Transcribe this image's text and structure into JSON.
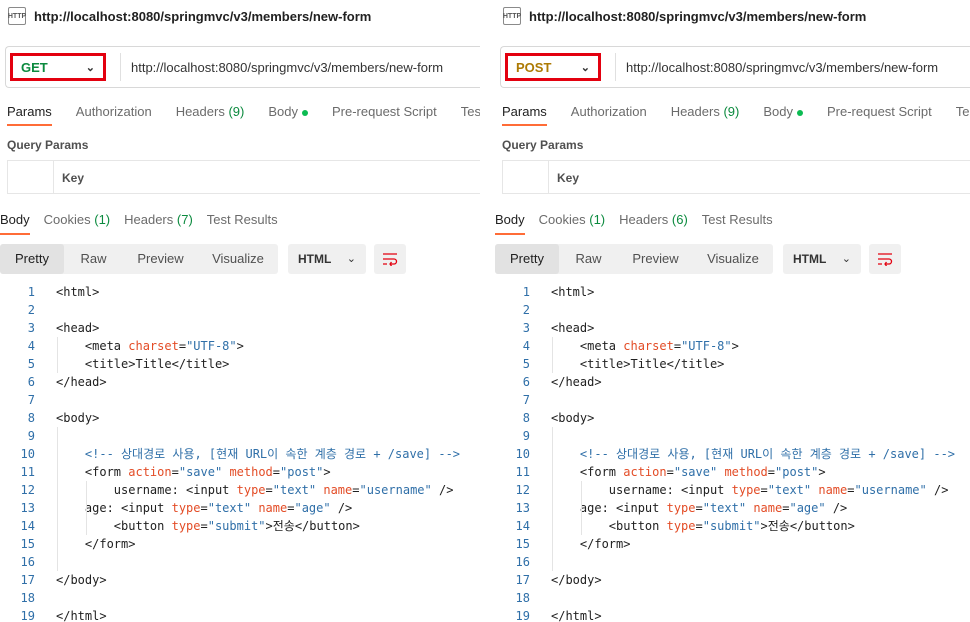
{
  "panels": [
    {
      "id": "left",
      "title_url": "http://localhost:8080/springmvc/v3/members/new-form",
      "method": "GET",
      "url": "http://localhost:8080/springmvc/v3/members/new-form",
      "request_tabs": [
        {
          "label": "Params",
          "active": true
        },
        {
          "label": "Authorization"
        },
        {
          "label": "Headers",
          "count": "(9)"
        },
        {
          "label": "Body",
          "dot": true
        },
        {
          "label": "Pre-request Script"
        },
        {
          "label": "Tes"
        }
      ],
      "query_params_title": "Query Params",
      "kv_key_header": "Key",
      "response_tabs": [
        {
          "label": "Body",
          "active": true
        },
        {
          "label": "Cookies",
          "count": "(1)"
        },
        {
          "label": "Headers",
          "count": "(7)"
        },
        {
          "label": "Test Results"
        }
      ],
      "format_tabs": [
        "Pretty",
        "Raw",
        "Preview",
        "Visualize"
      ],
      "format_active": "Pretty",
      "language": "HTML"
    },
    {
      "id": "right",
      "title_url": "http://localhost:8080/springmvc/v3/members/new-form",
      "method": "POST",
      "url": "http://localhost:8080/springmvc/v3/members/new-form",
      "request_tabs": [
        {
          "label": "Params",
          "active": true
        },
        {
          "label": "Authorization"
        },
        {
          "label": "Headers",
          "count": "(9)"
        },
        {
          "label": "Body",
          "dot": true
        },
        {
          "label": "Pre-request Script"
        },
        {
          "label": "Te"
        }
      ],
      "query_params_title": "Query Params",
      "kv_key_header": "Key",
      "response_tabs": [
        {
          "label": "Body",
          "active": true
        },
        {
          "label": "Cookies",
          "count": "(1)"
        },
        {
          "label": "Headers",
          "count": "(6)"
        },
        {
          "label": "Test Results"
        }
      ],
      "format_tabs": [
        "Pretty",
        "Raw",
        "Preview",
        "Visualize"
      ],
      "format_active": "Pretty",
      "language": "HTML"
    }
  ],
  "code_lines": [
    [
      {
        "t": "<html>",
        "c": "tag"
      }
    ],
    [],
    [
      {
        "t": "<head>",
        "c": "tag"
      }
    ],
    [
      {
        "t": "    <meta ",
        "c": "tag"
      },
      {
        "t": "charset",
        "c": "attr"
      },
      {
        "t": "=",
        "c": "tag"
      },
      {
        "t": "\"UTF-8\"",
        "c": "val"
      },
      {
        "t": ">",
        "c": "tag"
      }
    ],
    [
      {
        "t": "    <title>",
        "c": "tag"
      },
      {
        "t": "Title",
        "c": "tag"
      },
      {
        "t": "</title>",
        "c": "tag"
      }
    ],
    [
      {
        "t": "</head>",
        "c": "tag"
      }
    ],
    [],
    [
      {
        "t": "<body>",
        "c": "tag"
      }
    ],
    [],
    [
      {
        "t": "    <!-- 상대경로 사용, [현재 URL이 속한 계층 경로 + /save] -->",
        "c": "com"
      }
    ],
    [
      {
        "t": "    <form ",
        "c": "tag"
      },
      {
        "t": "action",
        "c": "attr"
      },
      {
        "t": "=",
        "c": "tag"
      },
      {
        "t": "\"save\"",
        "c": "val"
      },
      {
        "t": " ",
        "c": "tag"
      },
      {
        "t": "method",
        "c": "attr"
      },
      {
        "t": "=",
        "c": "tag"
      },
      {
        "t": "\"post\"",
        "c": "val"
      },
      {
        "t": ">",
        "c": "tag"
      }
    ],
    [
      {
        "t": "        username: <input ",
        "c": "tag"
      },
      {
        "t": "type",
        "c": "attr"
      },
      {
        "t": "=",
        "c": "tag"
      },
      {
        "t": "\"text\"",
        "c": "val"
      },
      {
        "t": " ",
        "c": "tag"
      },
      {
        "t": "name",
        "c": "attr"
      },
      {
        "t": "=",
        "c": "tag"
      },
      {
        "t": "\"username\"",
        "c": "val"
      },
      {
        "t": " />",
        "c": "tag"
      }
    ],
    [
      {
        "t": "    age: <input ",
        "c": "tag"
      },
      {
        "t": "type",
        "c": "attr"
      },
      {
        "t": "=",
        "c": "tag"
      },
      {
        "t": "\"text\"",
        "c": "val"
      },
      {
        "t": " ",
        "c": "tag"
      },
      {
        "t": "name",
        "c": "attr"
      },
      {
        "t": "=",
        "c": "tag"
      },
      {
        "t": "\"age\"",
        "c": "val"
      },
      {
        "t": " />",
        "c": "tag"
      }
    ],
    [
      {
        "t": "        <button ",
        "c": "tag"
      },
      {
        "t": "type",
        "c": "attr"
      },
      {
        "t": "=",
        "c": "tag"
      },
      {
        "t": "\"submit\"",
        "c": "val"
      },
      {
        "t": ">전송</button>",
        "c": "tag"
      }
    ],
    [
      {
        "t": "    </form>",
        "c": "tag"
      }
    ],
    [],
    [
      {
        "t": "</body>",
        "c": "tag"
      }
    ],
    [],
    [
      {
        "t": "</html>",
        "c": "tag"
      }
    ]
  ],
  "icons": {
    "http": "http-file-icon",
    "chevron": "chevron-down-icon",
    "wrap": "word-wrap-icon"
  },
  "colors": {
    "accent": "#ff6c37",
    "highlight_border": "#e3000f",
    "get": "#0b8a3e",
    "post": "#ad7a03"
  }
}
